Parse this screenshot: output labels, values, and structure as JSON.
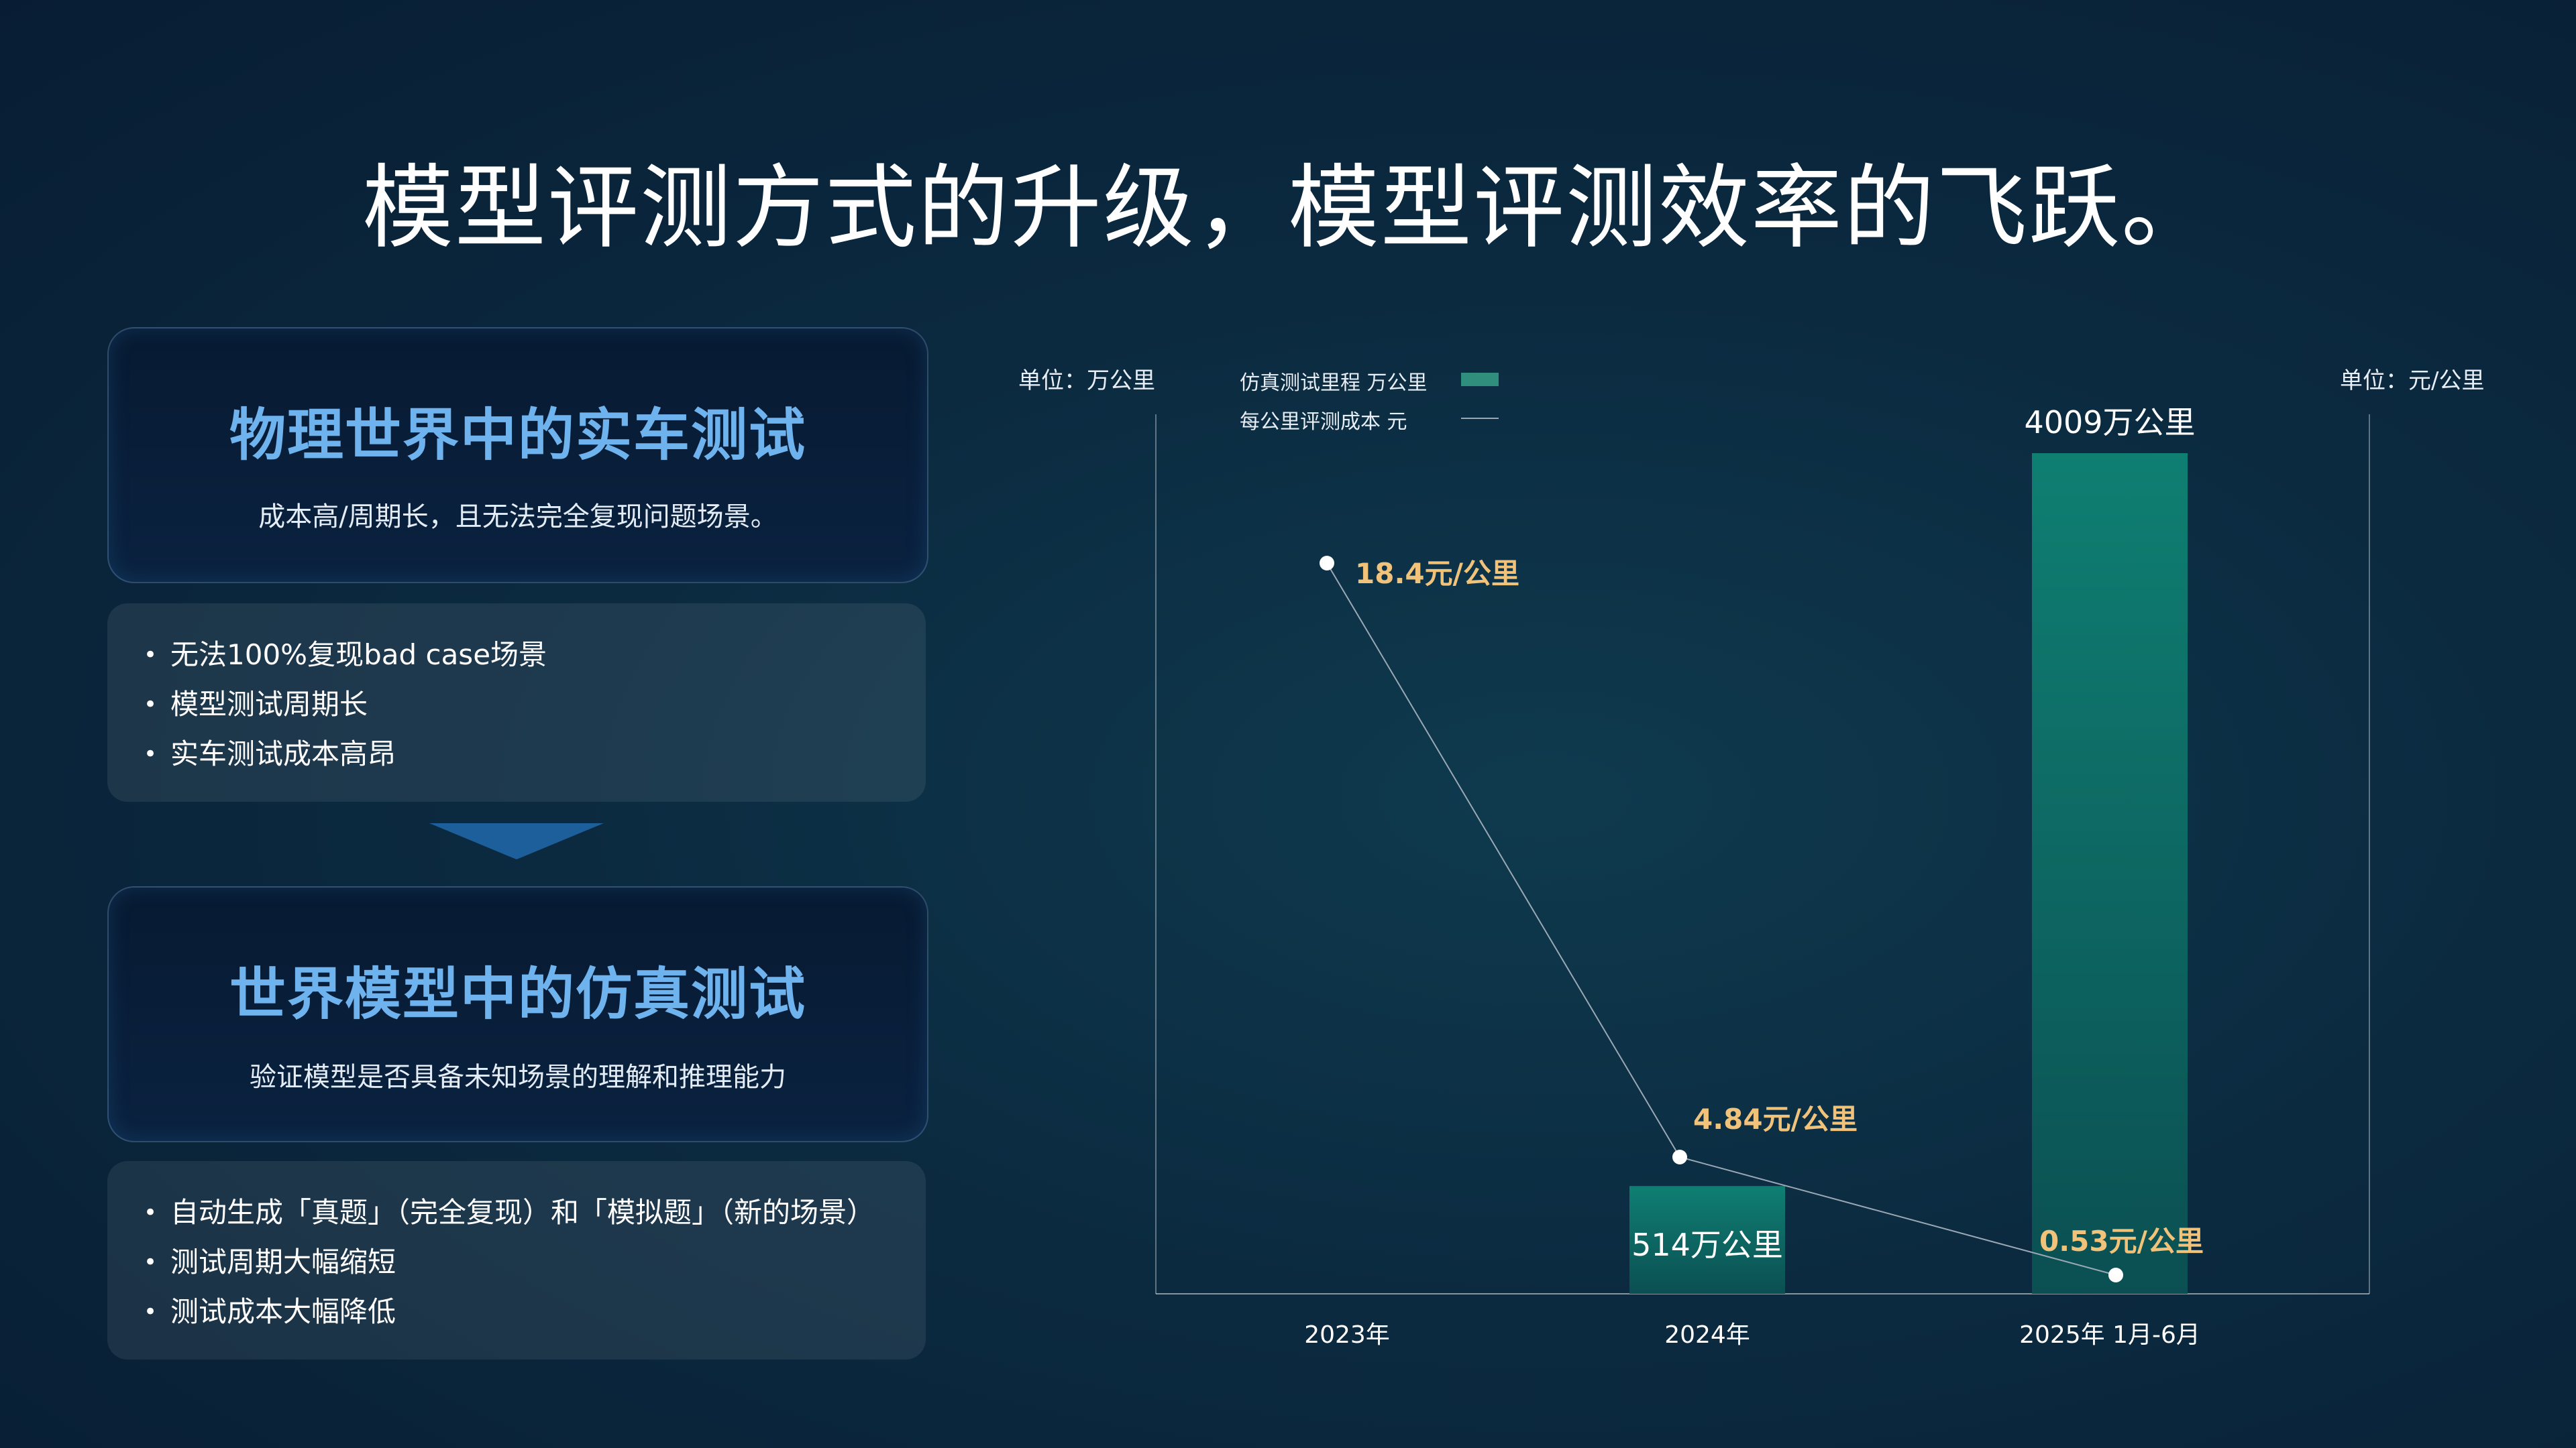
{
  "title": "模型评测方式的升级，模型评测效率的飞跃。",
  "left": {
    "card1": {
      "title": "物理世界中的实车测试",
      "subtitle": "成本高/周期长，且无法完全复现问题场景。"
    },
    "list1": [
      "无法100%复现bad case场景",
      "模型测试周期长",
      "实车测试成本高昂"
    ],
    "card2": {
      "title": "世界模型中的仿真测试",
      "subtitle": "验证模型是否具备未知场景的理解和推理能力"
    },
    "list2": [
      "自动生成「真题」（完全复现）和「模拟题」（新的场景）",
      "测试周期大幅缩短",
      "测试成本大幅降低"
    ]
  },
  "colors": {
    "bar": "#0f7f72",
    "line": "#9aa8b4",
    "value_label": "#f0c27a",
    "card_title": "#6fb3ee"
  },
  "chart_data": {
    "type": "bar",
    "categories": [
      "2023年",
      "2024年",
      "2025年 1月-6月"
    ],
    "y_left_unit": "单位：万公里",
    "y_right_unit": "单位：元/公里",
    "legend": [
      "仿真测试里程 万公里",
      "每公里评测成本 元"
    ],
    "series": [
      {
        "name": "仿真测试里程 万公里",
        "type": "bar",
        "values": [
          null,
          514,
          4009
        ],
        "labels": [
          "",
          "514万公里",
          "4009万公里"
        ]
      },
      {
        "name": "每公里评测成本 元",
        "type": "line",
        "values": [
          18.4,
          4.84,
          0.53
        ],
        "labels": [
          "18.4元/公里",
          "4.84元/公里",
          "0.53元/公里"
        ]
      }
    ],
    "ylim_left": [
      0,
      4009
    ],
    "ylim_right": [
      0,
      18.4
    ]
  }
}
